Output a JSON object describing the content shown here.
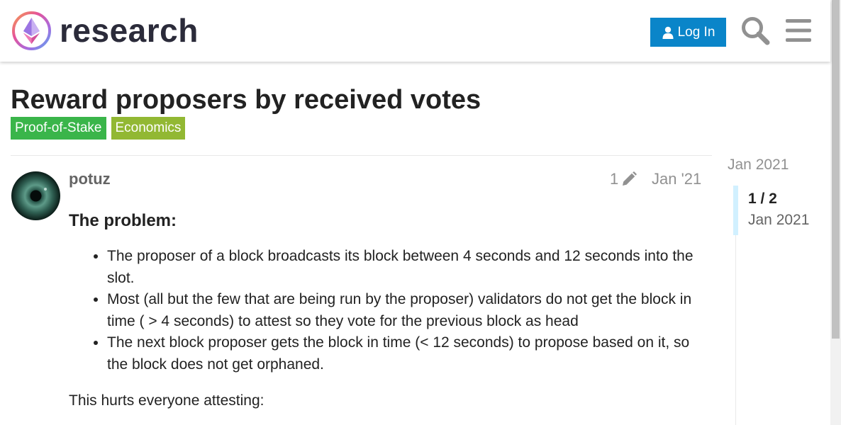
{
  "header": {
    "logo_text": "research",
    "login_label": "Log In"
  },
  "topic": {
    "title": "Reward proposers by received votes",
    "tags": [
      {
        "label": "Proof-of-Stake",
        "color": "#3ab54a"
      },
      {
        "label": "Economics",
        "color": "#92b833"
      }
    ]
  },
  "post": {
    "username": "potuz",
    "edit_count": "1",
    "date": "Jan '21",
    "heading": "The problem:",
    "bullets": [
      "The proposer of a block broadcasts its block between 4 seconds and 12 seconds into the slot.",
      "Most (all but the few that are being run by the proposer) validators do not get the block in time ( > 4 seconds) to attest so they vote for the previous block as head",
      "The next block proposer gets the block in time (< 12 seconds) to propose based on it, so the block does not get orphaned."
    ],
    "paragraph": "This hurts everyone attesting:"
  },
  "timeline": {
    "top_date": "Jan 2021",
    "position": "1 / 2",
    "current_date": "Jan 2021"
  },
  "icons": {
    "logo": "ethereum-logo-icon",
    "login": "user-icon",
    "search": "search-icon",
    "menu": "hamburger-menu-icon",
    "edit": "pencil-icon"
  },
  "colors": {
    "login_button": "#0a85c9",
    "timeline_handle": "#d1f0ff"
  }
}
